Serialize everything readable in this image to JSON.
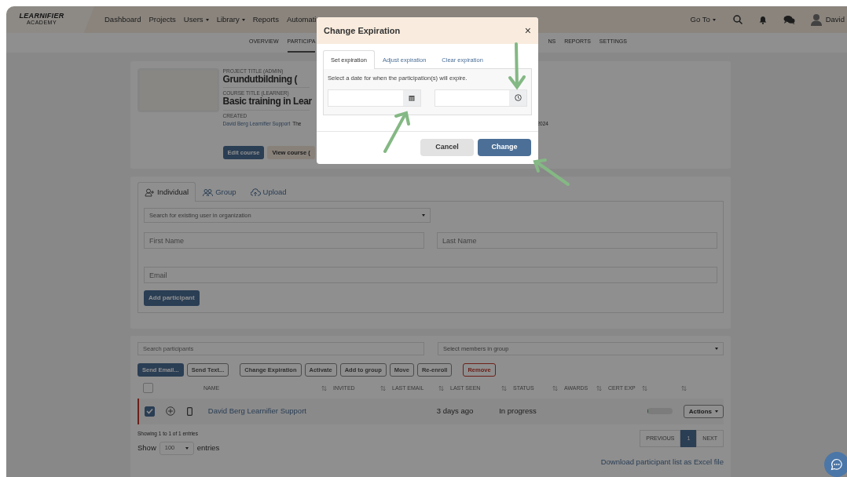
{
  "navbar": {
    "logo": "LEARNIFIER",
    "logo_tagline": "ACADEMY",
    "items": [
      {
        "label": "Dashboard",
        "dropdown": false
      },
      {
        "label": "Projects",
        "dropdown": false
      },
      {
        "label": "Users",
        "dropdown": true
      },
      {
        "label": "Library",
        "dropdown": true
      },
      {
        "label": "Reports",
        "dropdown": false
      },
      {
        "label": "Automati",
        "dropdown": false
      }
    ],
    "goto": "Go To",
    "user": "David"
  },
  "subnav": [
    {
      "label": "OVERVIEW",
      "selected": false
    },
    {
      "label": "PARTICIPA",
      "selected": true
    },
    {
      "label": "NS",
      "selected": false
    },
    {
      "label": "REPORTS",
      "selected": false
    },
    {
      "label": "SETTINGS",
      "selected": false
    }
  ],
  "project": {
    "project_label": "PROJECT TITLE (ADMIN)",
    "project_title": "Grundutbildning (",
    "course_label": "COURSE TITLE (LEARNER)",
    "course_title": "Basic training in Lear",
    "created_label": "CREATED",
    "created_by": "David Berg Learnifier Support",
    "created_date_start": "The",
    "created_date_end": "2024",
    "buttons": [
      {
        "label": "Edit course",
        "kind": "primary"
      },
      {
        "label": "View course (",
        "kind": "secondary"
      }
    ]
  },
  "add_form": {
    "tabs": [
      {
        "label": "Individual",
        "selected": true,
        "kind": "person"
      },
      {
        "label": "Group",
        "selected": false,
        "kind": "group"
      },
      {
        "label": "Upload",
        "selected": false,
        "kind": "upload"
      }
    ],
    "user_search": {
      "placeholder": "Search for existing user in organization"
    },
    "first_name": {
      "placeholder": "First Name"
    },
    "last_name": {
      "placeholder": "Last Name"
    },
    "email": {
      "placeholder": "Email"
    },
    "submit": "Add participant"
  },
  "participants": {
    "search": {
      "placeholder": "Search participants"
    },
    "group_select": {
      "placeholder": "Select members in group"
    },
    "actions": [
      {
        "label": "Send Email...",
        "kind": "primary"
      },
      {
        "label": "Send Text...",
        "kind": "outline"
      },
      {
        "label": "Change Expiration",
        "kind": "outline"
      },
      {
        "label": "Activate",
        "kind": "outline"
      },
      {
        "label": "Add to group",
        "kind": "outline"
      },
      {
        "label": "Move",
        "kind": "outline"
      },
      {
        "label": "Re-enroll",
        "kind": "outline"
      },
      {
        "label": "Remove",
        "kind": "danger"
      }
    ],
    "select_all_checked": false,
    "columns": [
      "NAME",
      "INVITED",
      "LAST EMAIL",
      "LAST SEEN",
      "STATUS",
      "AWARDS",
      "CERT EXP"
    ],
    "rows": [
      {
        "checked": true,
        "name": "David Berg Learnifier Support",
        "last_seen": "3 days ago",
        "status": "In progress",
        "level": 0.05,
        "actions": "Actions"
      }
    ],
    "info": "Showing 1 to 1 of 1 entries",
    "pagination": {
      "previous": "PREVIOUS",
      "pages": [
        {
          "label": "1",
          "selected": true
        }
      ],
      "next": "NEXT"
    },
    "length": {
      "prefix": "Show",
      "value": "100",
      "suffix": "entries"
    },
    "download": "Download participant list as Excel file"
  },
  "modal": {
    "title": "Change Expiration",
    "close": "×",
    "tabs": [
      {
        "label": "Set expiration",
        "selected": true
      },
      {
        "label": "Adjust expiration",
        "selected": false
      },
      {
        "label": "Clear expiration",
        "selected": false
      }
    ],
    "hint": "Select a date for when the participation(s) will expire.",
    "buttons": [
      {
        "label": "Cancel",
        "kind": "secondary"
      },
      {
        "label": "Change",
        "kind": "primary"
      }
    ]
  }
}
